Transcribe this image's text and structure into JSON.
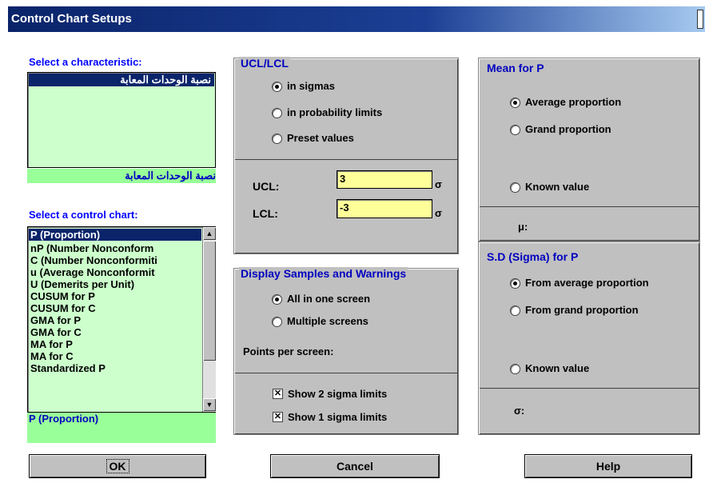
{
  "window": {
    "title": "Control Chart Setups"
  },
  "characteristic": {
    "label": "Select a characteristic:",
    "items": [
      "نصبة الوحدات المعابة"
    ],
    "selected": "نصبة الوحدات المعابة"
  },
  "control_chart": {
    "label": "Select a control chart:",
    "items": [
      "P (Proportion)",
      "nP (Number Nonconform",
      "C (Number Nonconformiti",
      "u (Average Nonconformit",
      "U (Demerits per Unit)",
      "CUSUM for P",
      "CUSUM for C",
      "GMA for P",
      "GMA for C",
      "MA for P",
      "MA for C",
      "Standardized P"
    ],
    "selected": "P (Proportion)"
  },
  "ucl_lcl": {
    "title": "UCL/LCL",
    "options": [
      "in sigmas",
      "in probability limits",
      "Preset values"
    ],
    "ucl_label": "UCL:",
    "ucl_value": "3",
    "lcl_label": "LCL:",
    "lcl_value": "-3",
    "sigma_symbol": "σ"
  },
  "display": {
    "title": "Display Samples and Warnings",
    "options": [
      "All in one screen",
      "Multiple screens"
    ],
    "points_label": "Points per screen:",
    "checks": [
      "Show 2 sigma limits",
      "Show 1 sigma limits"
    ]
  },
  "mean": {
    "title": "Mean for P",
    "options": [
      "Average proportion",
      "Grand proportion",
      "Known value"
    ],
    "mu_label": "μ:"
  },
  "sd": {
    "title": "S.D (Sigma) for P",
    "options": [
      "From average proportion",
      "From grand proportion",
      "Known value"
    ],
    "sigma_label": "σ:"
  },
  "buttons": {
    "ok": "OK",
    "cancel": "Cancel",
    "help": "Help"
  }
}
